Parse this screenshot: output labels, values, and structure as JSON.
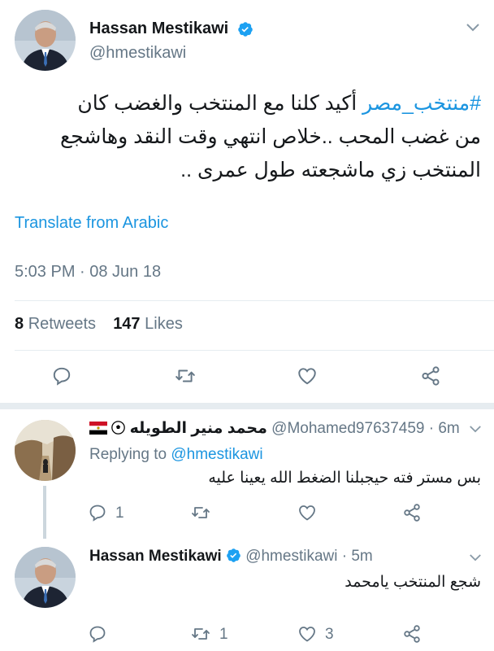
{
  "main_tweet": {
    "author_name": "Hassan Mestikawi",
    "handle": "@hmestikawi",
    "hashtag": "#منتخب_مصر",
    "text_line1_rest": "أكيد كلنا مع المنتخب والغضب كان",
    "text_line2": "من غضب المحب ..خلاص انتهي وقت النقد وهاشجع",
    "text_line3": "المنتخب زي ماشجعته طول عمرى ..",
    "translate": "Translate from Arabic",
    "timestamp": "5:03 PM · 08 Jun 18",
    "retweets_count": "8",
    "retweets_label": "Retweets",
    "likes_count": "147",
    "likes_label": "Likes"
  },
  "reply1": {
    "author_name": "محمد منير الطويله",
    "handle_time": "@Mohamed97637459 · 6m",
    "replying_prefix": "Replying to",
    "replying_handle": "@hmestikawi",
    "text": "بس مستر فته حيجبلنا الضغط الله يعينا عليه",
    "reply_count": "1"
  },
  "reply2": {
    "author_name": "Hassan Mestikawi",
    "handle_time": "@hmestikawi · 5m",
    "text": "شجع المنتخب يامحمد",
    "retweet_count": "1",
    "like_count": "3"
  },
  "colors": {
    "accent": "#1b95e0",
    "muted": "#657786",
    "divider": "#e6ecf0"
  },
  "icons": [
    "chevron-down-icon",
    "verified-badge-icon",
    "reply-icon",
    "retweet-icon",
    "like-icon",
    "share-icon",
    "soccer-ball-emoji",
    "egypt-flag-emoji"
  ]
}
